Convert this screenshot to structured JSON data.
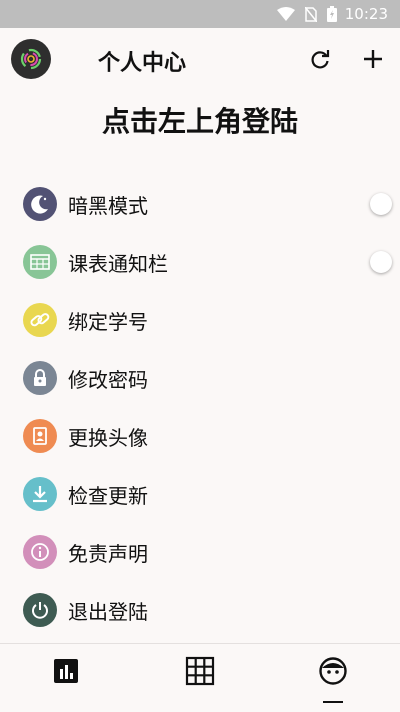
{
  "status_bar": {
    "time": "10:23"
  },
  "header": {
    "title": "个人中心"
  },
  "login_prompt": "点击左上角登陆",
  "menu": {
    "items": [
      {
        "label": "暗黑模式",
        "icon": "moon-icon",
        "color": "#525274",
        "has_toggle": true
      },
      {
        "label": "课表通知栏",
        "icon": "calendar-icon",
        "color": "#88c596",
        "has_toggle": true
      },
      {
        "label": "绑定学号",
        "icon": "link-icon",
        "color": "#e9d750",
        "has_toggle": false
      },
      {
        "label": "修改密码",
        "icon": "lock-icon",
        "color": "#7b8694",
        "has_toggle": false
      },
      {
        "label": "更换头像",
        "icon": "portrait-icon",
        "color": "#ef8b52",
        "has_toggle": false
      },
      {
        "label": "检查更新",
        "icon": "download-icon",
        "color": "#66bfca",
        "has_toggle": false
      },
      {
        "label": "免责声明",
        "icon": "info-icon",
        "color": "#d28fba",
        "has_toggle": false
      },
      {
        "label": "退出登陆",
        "icon": "power-icon",
        "color": "#3e5b52",
        "has_toggle": false
      }
    ]
  },
  "tab_bar": {
    "tabs": [
      {
        "icon": "chart-icon",
        "selected": false
      },
      {
        "icon": "grid-icon",
        "selected": false
      },
      {
        "icon": "face-icon",
        "selected": true
      }
    ]
  }
}
